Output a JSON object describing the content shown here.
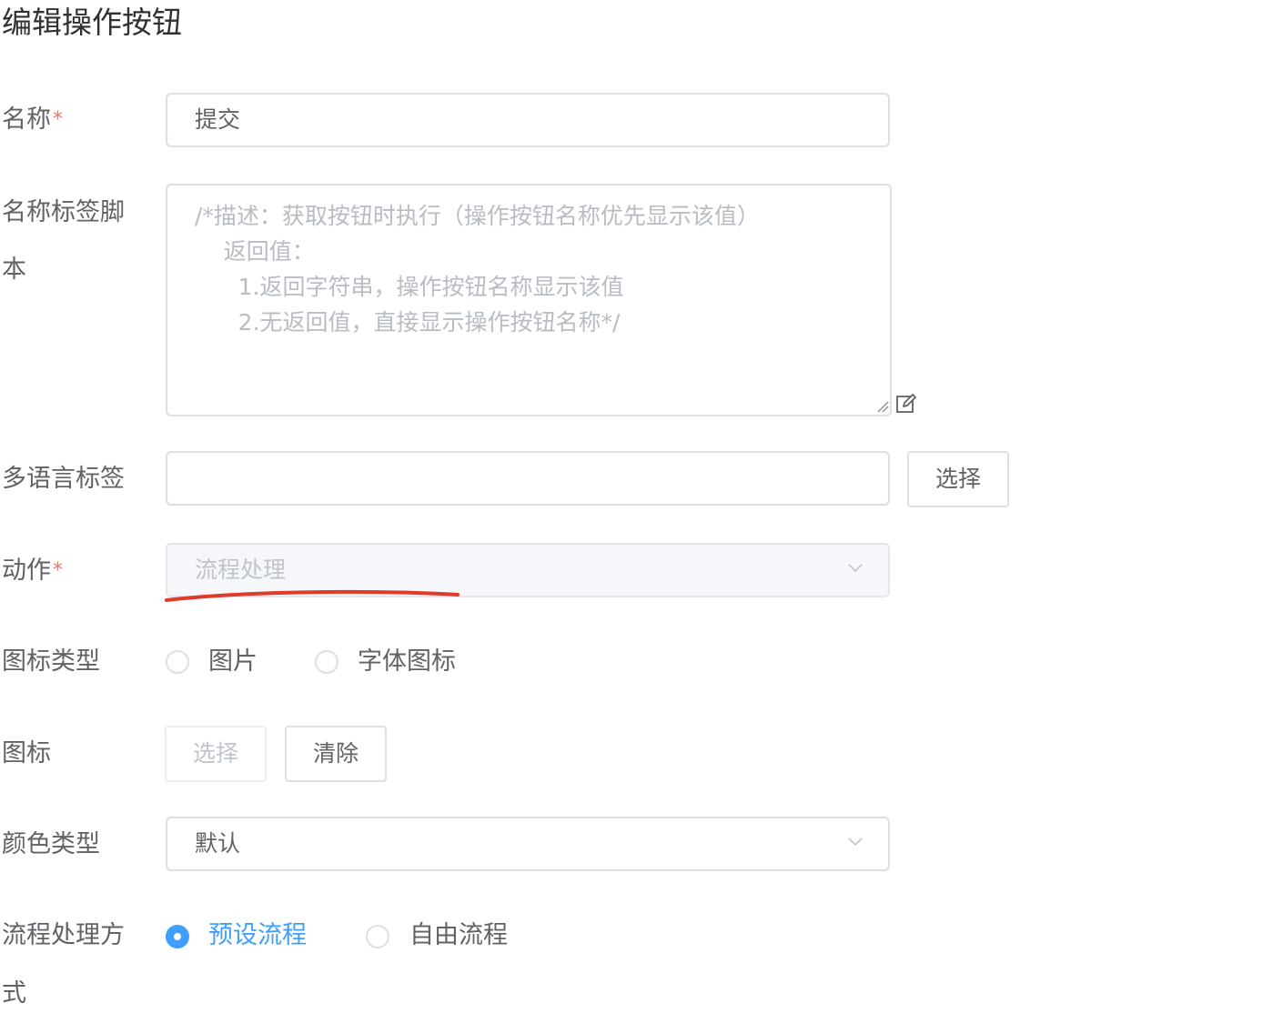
{
  "page": {
    "title": "编辑操作按钮"
  },
  "form": {
    "required_mark": "*",
    "name": {
      "label": "名称",
      "value": "提交"
    },
    "name_script": {
      "label_line1": "名称标签脚",
      "label_line2": "本",
      "placeholder": "/*描述：获取按钮时执行（操作按钮名称优先显示该值）\n    返回值：\n      1.返回字符串，操作按钮名称显示该值\n      2.无返回值，直接显示操作按钮名称*/"
    },
    "i18n_label": {
      "label": "多语言标签",
      "value": "",
      "select_button": "选择"
    },
    "action": {
      "label": "动作",
      "value": "流程处理"
    },
    "icon_type": {
      "label": "图标类型",
      "options": [
        "图片",
        "字体图标"
      ],
      "selected": null
    },
    "icon": {
      "label": "图标",
      "select_button": "选择",
      "clear_button": "清除"
    },
    "color_type": {
      "label": "颜色类型",
      "value": "默认"
    },
    "flow_mode": {
      "label_line1": "流程处理方",
      "label_line2": "式",
      "options": [
        "预设流程",
        "自由流程"
      ],
      "selected": "预设流程"
    }
  },
  "icons": {
    "edit": "edit-icon",
    "chevron": "chevron-down-icon"
  },
  "colors": {
    "primary": "#409eff",
    "required": "#f56c6c",
    "annotation": "#e03a2a"
  }
}
